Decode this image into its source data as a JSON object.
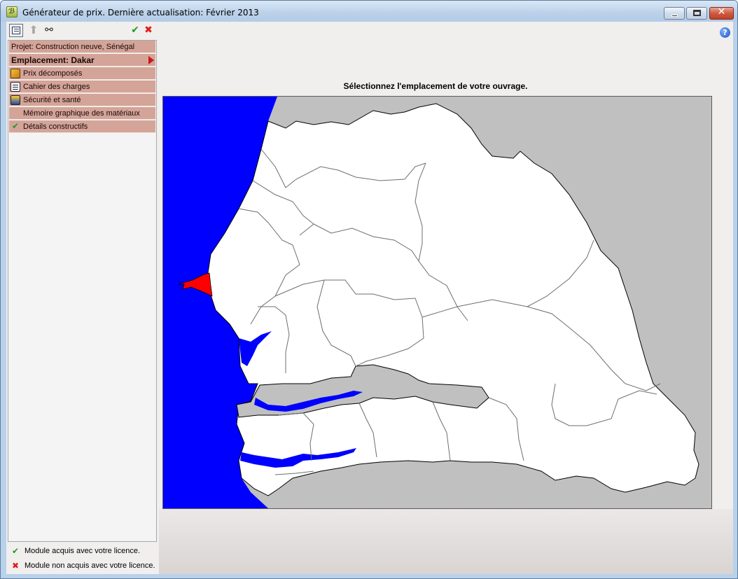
{
  "window": {
    "title": "Générateur de prix. Dernière actualisation: Février 2013",
    "icon": "app-icon",
    "controls": [
      "minimize-icon",
      "maximize-icon",
      "close-icon"
    ]
  },
  "toolbar": {
    "items": [
      "list-view-icon",
      "up-arrow-icon",
      "binoculars-icon",
      "check-icon",
      "cross-icon"
    ]
  },
  "tree": {
    "project": "Projet: Construction neuve, Sénégal",
    "location": "Emplacement: Dakar",
    "items": [
      {
        "label": "Prix décomposés",
        "icon": "price-icon"
      },
      {
        "label": "Cahier des charges",
        "icon": "specification-icon"
      },
      {
        "label": "Sécurité et santé",
        "icon": "safety-icon"
      },
      {
        "label": "Mémoire graphique des matériaux",
        "icon": ""
      },
      {
        "label": "Détails constructifs",
        "icon": "check-icon"
      }
    ]
  },
  "legend": {
    "acquired": "Module acquis avec votre licence.",
    "not_acquired": "Module non acquis avec votre licence."
  },
  "map": {
    "prompt": "Sélectionnez l'emplacement de votre ouvrage.",
    "selected_region": "Dakar",
    "colors": {
      "ocean": "#0000ff",
      "land": "#ffffff",
      "outside": "#c0c0c0",
      "selected": "#ff0000",
      "borders": "#000000"
    }
  },
  "colors": {
    "tree_row": "#d4a498",
    "check": "#1e9a1e",
    "cross": "#e21b1b"
  }
}
